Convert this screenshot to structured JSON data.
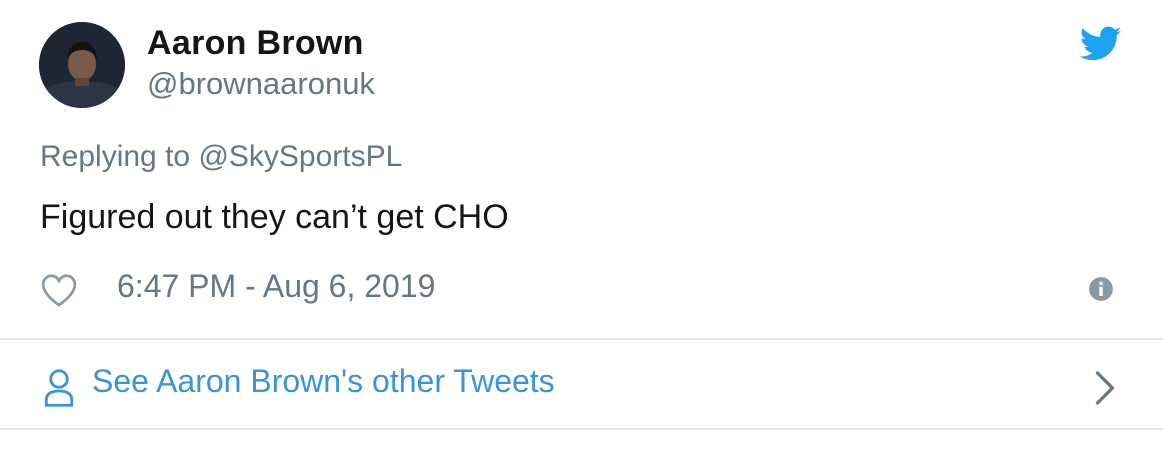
{
  "author": {
    "name": "Aaron Brown",
    "handle": "@brownaaronuk"
  },
  "reply": {
    "prefix": "Replying to",
    "mention": "@SkySportsPL"
  },
  "tweet": {
    "text": "Figured out they can’t get CHO",
    "timestamp": "6:47 PM - Aug 6, 2019"
  },
  "footer": {
    "see_more_label": "See Aaron Brown's other Tweets"
  },
  "icons": {
    "brand": "bird-icon",
    "like": "heart-icon",
    "info": "info-icon",
    "profile": "person-icon",
    "more": "chevron-right-icon"
  },
  "colors": {
    "accent": "#1da1f2",
    "link": "#3b94d9",
    "text": "#14171a",
    "muted": "#657786",
    "divider": "#e1e8ed"
  }
}
